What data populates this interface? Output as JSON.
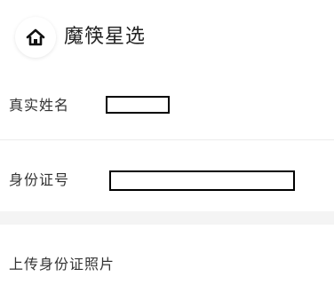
{
  "header": {
    "title": "魔筷星选",
    "home_icon": "home-icon"
  },
  "form": {
    "real_name": {
      "label": "真实姓名",
      "value": "",
      "placeholder": ""
    },
    "id_number": {
      "label": "身份证号",
      "value": "",
      "placeholder": ""
    },
    "upload": {
      "label": "上传身份证照片"
    }
  },
  "colors": {
    "text": "#222222",
    "divider": "#ececec",
    "section_gap": "#f4f4f4",
    "input_border": "#000000"
  }
}
